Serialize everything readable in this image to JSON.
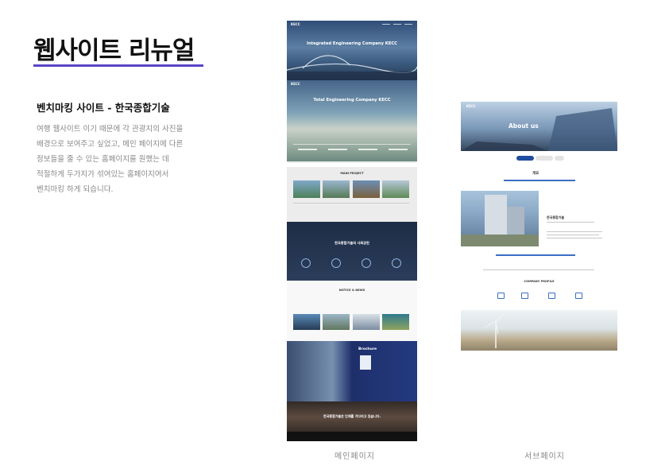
{
  "page": {
    "title": "웹사이트 리뉴얼",
    "subtitle": "벤치마킹 사이트 - 한국종합기술",
    "description_lines": [
      "여행 웹사이트 이기 때문에 각 관광지의 사진을",
      "배경으로 보여주고 싶었고, 메인 페이지에 다른",
      "정보들을 줄 수 있는 홈페이지를 원했는 데",
      "적절하게 두가지가 섞여있는 홈페이지여서",
      "벤치마킹 하게 되습니다."
    ],
    "captions": {
      "main": "메인페이지",
      "sub": "서브페이지"
    },
    "accent_color": "#5a44c8"
  },
  "main_mockup": {
    "logo": "KECC",
    "hero1_text": "Integrated Engineering Company KECC",
    "hero2_text": "Total Engineering Company KECC",
    "business_heading": "MAIN PROJECT",
    "dark_heading": "한국종합기술의 사회공헌",
    "news_heading": "NOTICE & NEWS",
    "hq_heading": "Brochure",
    "people_text": "한국종합기술은 인재를 기다리고 있습니다."
  },
  "sub_mockup": {
    "logo": "KECC",
    "hero_text": "About us",
    "section_heading": "개요",
    "intro_text": "한국종합기술",
    "profile_heading": "COMPANY PROFILE"
  }
}
